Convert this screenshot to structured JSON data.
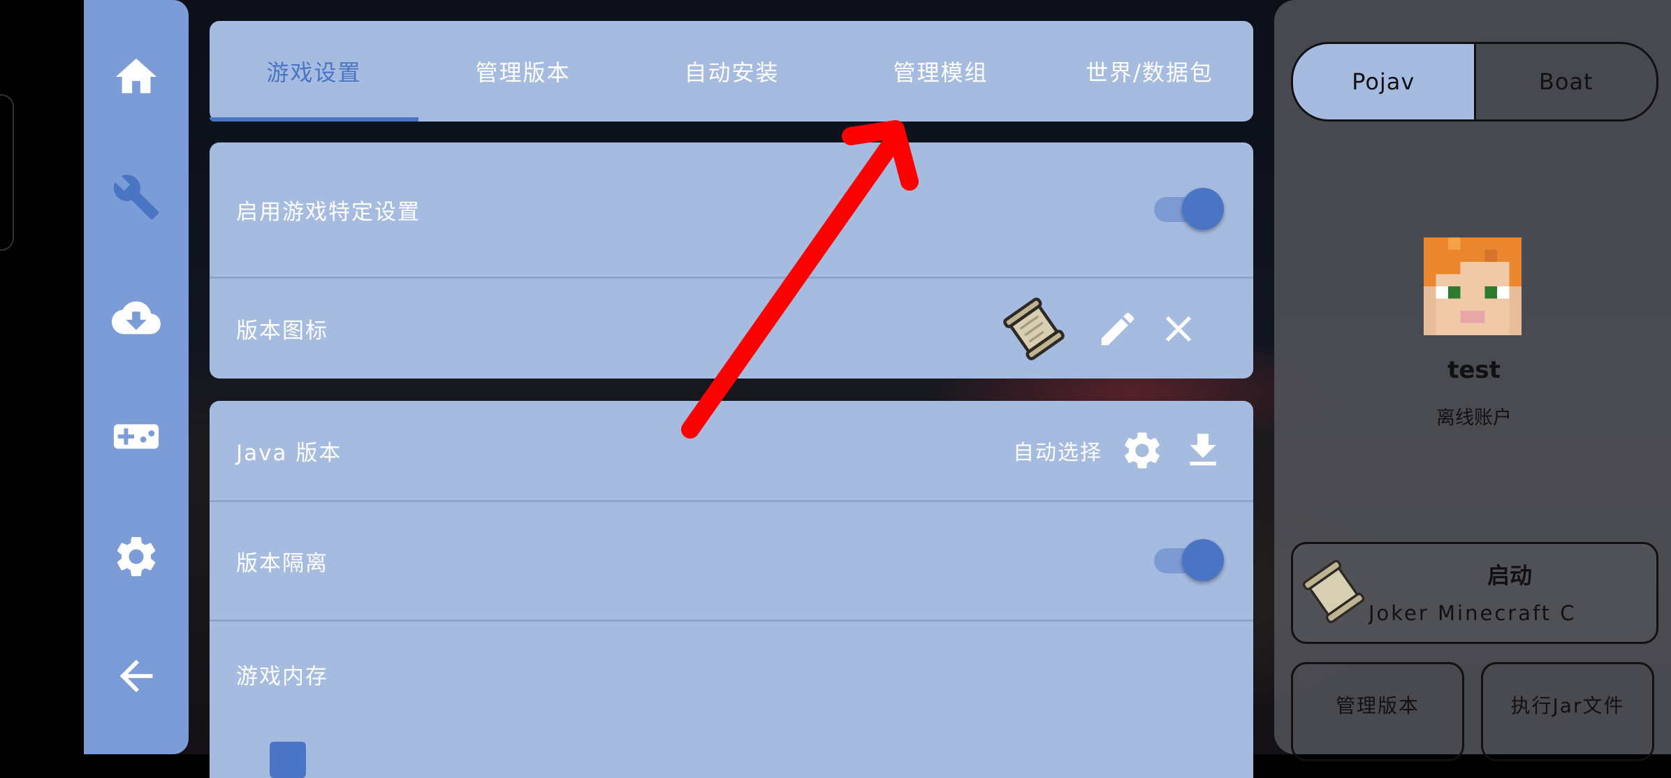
{
  "tabs": [
    {
      "label": "游戏设置",
      "active": true
    },
    {
      "label": "管理版本",
      "active": false
    },
    {
      "label": "自动安装",
      "active": false
    },
    {
      "label": "管理模组",
      "active": false
    },
    {
      "label": "世界/数据包",
      "active": false
    }
  ],
  "nav": {
    "items": [
      "home-icon",
      "wrench-icon",
      "cloud-download-icon",
      "gamepad-icon",
      "gear-icon",
      "back-arrow-icon"
    ]
  },
  "settings": {
    "enable_specific": {
      "label": "启用游戏特定设置",
      "on": true
    },
    "version_icon": {
      "label": "版本图标"
    },
    "java": {
      "label": "Java 版本",
      "value": "自动选择"
    },
    "isolation": {
      "label": "版本隔离",
      "on": true
    },
    "memory": {
      "label": "游戏内存"
    }
  },
  "side": {
    "launcher_options": [
      {
        "label": "Pojav",
        "active": true
      },
      {
        "label": "Boat",
        "active": false
      }
    ],
    "username": "test",
    "account_type": "离线账户",
    "launch": {
      "title": "启动",
      "version": "Joker Minecraft Cli"
    },
    "manage_versions": "管理版本",
    "run_jar": "执行Jar文件"
  },
  "colors": {
    "accent": "#4a74c4",
    "panel": "#a6bbe0",
    "nav": "#7b9cd6",
    "annotation": "#ff0000"
  }
}
